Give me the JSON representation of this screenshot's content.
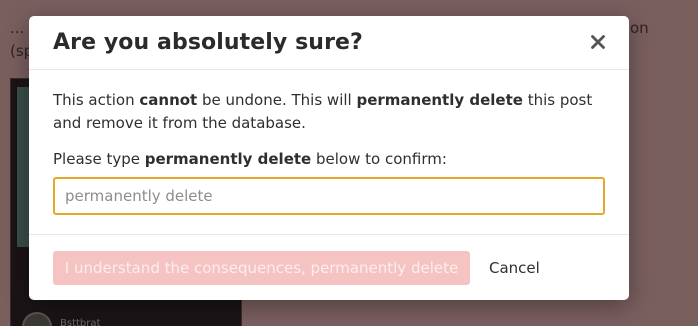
{
  "background": {
    "text_left_top": "... a",
    "text_left_2": "(sp",
    "text_right": "on",
    "username": "Bsttbrat"
  },
  "modal": {
    "title": "Are you absolutely sure?",
    "close_icon": "close-icon",
    "description": {
      "part1": "This action ",
      "bold1": "cannot",
      "part2": " be undone. This will ",
      "bold2": "permanently delete",
      "part3": " this post and remove it from the database."
    },
    "prompt": {
      "part1": "Please type ",
      "bold": "permanently delete",
      "part2": " below to confirm:"
    },
    "input": {
      "value": "",
      "placeholder": "permanently delete"
    },
    "confirm_button_label": "I understand the consequences, permanently delete",
    "cancel_button_label": "Cancel"
  },
  "colors": {
    "overlay": "#7a5f5f",
    "input_focus_border": "#e3a82a",
    "danger_disabled": "#f6c3c3"
  }
}
